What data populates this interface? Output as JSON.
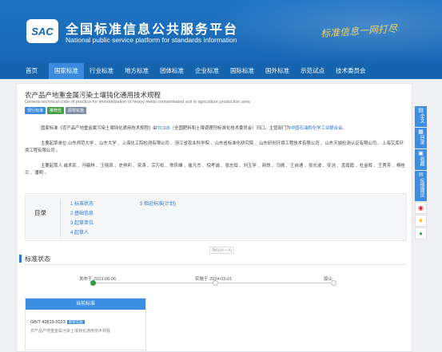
{
  "header": {
    "logo_text": "SAC",
    "title_cn": "全国标准信息公共服务平台",
    "title_en": "National public service platform  for standards information",
    "slogan": "标准信息一网打尽"
  },
  "nav": [
    "首页",
    "国家标准",
    "行业标准",
    "地方标准",
    "团体标准",
    "企业标准",
    "国际标准",
    "国外标准",
    "示范试点",
    "技术委员会"
  ],
  "standard": {
    "title": "农产品产地重金属污染土壤钝化通用技术规程",
    "title_en": "General technical code of practice for immobilization of heavy metal contaminated soil in agriculture production area",
    "badges": [
      "现行标准",
      "推荐性",
      "即将实施"
    ]
  },
  "para1": {
    "pre": "国家标准《农产品产地重金属污染土壤钝化通用技术规程》由",
    "tc": "TC105",
    "mid": "（全国肥料和土壤调理剂标准化技术委员会）归口，主管部门为",
    "dept": "中国石油和化学工业联合会",
    "post": "。"
  },
  "para2": "主要起草单位 山东师范大学 、山东大学 、上海化工院检测有限公司 、浙江省农业科学院 、山东省标准化研究院 、山东研创环境工程技术有限公司 、山东天城检测认证有限公司 、上海艾库环境工程有限公司 。",
  "para3": "主要起草人 戚术民 、冯毓林 、王晓凤 、史祥利 、宋涛 、宗万松 、陈庆峰 、崔凡杰 、倪考诚 、张志恒 、刘玉学 、商悦 、马振 、王自通 、张长波 、安洁 、孟霞霞 、杜金辉 、王秀芳 、杨桂兰 、潘明 。",
  "catalog": {
    "label": "目录",
    "items": [
      "1 标准状态",
      "2 基础信息",
      "3 起草单位",
      "4 起草人",
      "5 相近标准(计划)"
    ],
    "hint": "相似(A + A)"
  },
  "status": {
    "title": "标准状态",
    "published": "发布于 2023-08-06",
    "implemented": "实施于 2024-03-01",
    "abolished": "废止",
    "progress_fraction": 0.0
  },
  "current": {
    "header": "当前标准",
    "code": "GB/T 42819-2023",
    "tag": "即将实施",
    "name": "农产品产地重金属污染土壤钝化通用技术规程"
  },
  "side_tools": [
    {
      "icon": "document-icon",
      "label": "全文"
    },
    {
      "icon": "grid-icon",
      "label": "目录"
    },
    {
      "icon": "lock-icon",
      "label": "收藏"
    },
    {
      "icon": "chat-icon",
      "label": "反馈建议"
    }
  ],
  "social": [
    "weibo-icon",
    "qzone-icon",
    "wechat-icon"
  ]
}
